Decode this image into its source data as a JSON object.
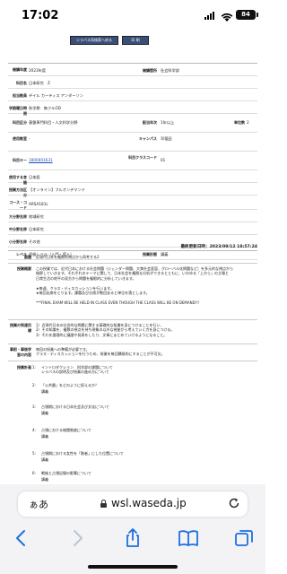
{
  "status": {
    "time": "17:02",
    "battery": "84"
  },
  "top_buttons": {
    "syllabus_search": "シラバス再検索へ戻る",
    "print": "印 刷"
  },
  "info": {
    "year_label": "開講年度",
    "year": "2023年度",
    "dept_label": "開講箇所",
    "dept": "社会科学部",
    "course_label": "科目名",
    "course": "日本研究　Z",
    "instructor_label": "担当教員",
    "instructor": "デイル カーティス アンダーソン",
    "term_label": "学期曜日時限",
    "term": "秋学期　無フルOD",
    "category_label": "科目区分",
    "category": "基盤専門科目・人文科学分野",
    "grade_label": "配当年次",
    "grade": "1年以上",
    "credits_label": "単位数",
    "credits": "2",
    "classroom_label": "使用教室",
    "classroom": "-",
    "campus_label": "キャンパス",
    "campus": "早稲田",
    "key_label": "科目キー",
    "key": "1800001631",
    "class_code_label": "科目クラスコード",
    "class_code": "01",
    "lang_label": "使用する言語",
    "lang": "日本語",
    "method_label": "授業方法区分",
    "method": "【オンライン】フルオンデマンド",
    "code_label": "コース・コード",
    "code": "ARSA181L",
    "major_label": "大分野名称",
    "major": "地域研究",
    "middle_label": "中分野名称",
    "middle": "日本研究",
    "minor_label": "小分野名称",
    "minor": "その他",
    "level_label": "レベル",
    "level": "初級レベル（入門・導入）",
    "form_label": "授業形態",
    "form": "講義"
  },
  "updated": "最終更新日時：2023/09/12 18:57:24",
  "sections": {
    "subtitle_label": "副題",
    "subtitle": "近現代日本を複数的視点から再考する2",
    "summary_label": "授業概要",
    "summary": "この授業では、近代日本における社会問題（ジェンダー問題、大衆社会変容、グローバル化問題など）を多元的な視点から\n検察していきます。それぞれのテーマに関して、日本社会を複眼な分析ができるとともに、いわゆる「上から」の立場と\n日常生活の地平の双方から問題を複眼的に分析していきます。\n\n★毎週、クラス・ディスカッションを行います。\n★毎回出席をとります。課題及び欠席が数回あると単位を落とします。\n\n***FINAL EXAM WILL BE HELD IN CLASS EVEN THOUGH THE CLASS WILL BE ON DEMAND!!!",
    "goal_label": "授業の到達目標",
    "goal": "1）近現代日本の社会的な問題に関する基礎的な知識を身につけることを行い、\n2）その知識を、複数の視点を持ち現象の以外な視座から考えていく力を身につける。\n3）それを論理的に議論や発表をしたり、文章にまとめていけるようになること。",
    "prep_label": "事前・事後学習の内容",
    "prep": "毎回の授業への準備が必要です。\nクラス・ディスカッションを行うため、授業を毎回積極的にすることが不可欠。",
    "plan_label": "授業計画"
  },
  "schedule": [
    {
      "num": "1:",
      "title": "イントロダクション　科学部の課題について\nシラバスの説明及び授業の進め方について",
      "mode": ""
    },
    {
      "num": "2:",
      "title": "「公共圏」をどのように捉えるか？",
      "mode": "講義"
    },
    {
      "num": "3:",
      "title": "占領期における日本社会及び文化について",
      "mode": "講義"
    },
    {
      "num": "4:",
      "title": "占領における検閲制度について",
      "mode": "講義"
    },
    {
      "num": "5:",
      "title": "占領期における女性を「敗者」にした位置について",
      "mode": "講義"
    },
    {
      "num": "6:",
      "title": "戦後と占領記憶の影響について",
      "mode": "講義"
    }
  ],
  "browser": {
    "aa": "ぁあ",
    "url": "wsl.waseda.jp"
  }
}
